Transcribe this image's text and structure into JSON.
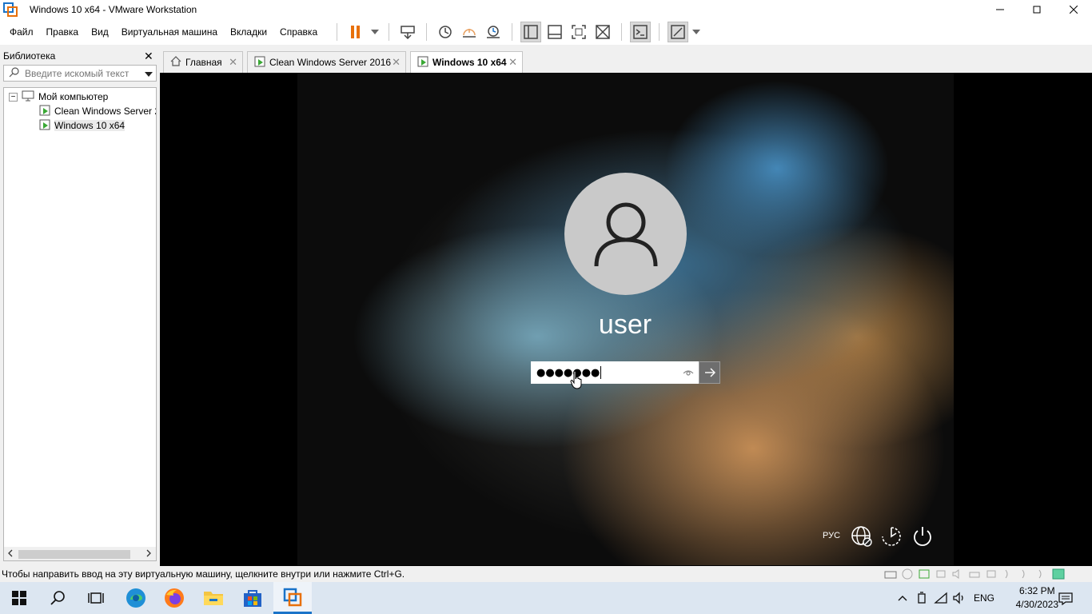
{
  "window": {
    "title": "Windows 10 x64 - VMware Workstation"
  },
  "menu": [
    "Файл",
    "Правка",
    "Вид",
    "Виртуальная машина",
    "Вкладки",
    "Справка"
  ],
  "library": {
    "header": "Библиотека",
    "search_placeholder": "Введите искомый текст",
    "tree": {
      "root": "Мой компьютер",
      "items": [
        "Clean Windows Server 2",
        "Windows 10 x64"
      ]
    }
  },
  "tabs": [
    {
      "label": "Главная"
    },
    {
      "label": "Clean Windows Server 2016"
    },
    {
      "label": "Windows 10 x64"
    }
  ],
  "lockscreen": {
    "username": "user",
    "password_mask": "●●●●●●●",
    "language": "РУС"
  },
  "statusbar": {
    "message": "Чтобы направить ввод на эту виртуальную машину, щелкните внутри или нажмите Ctrl+G."
  },
  "taskbar": {
    "input_lang": "ENG",
    "time": "6:32 PM",
    "date": "4/30/2023"
  },
  "colors": {
    "accent": "#1a73c8",
    "pause_orange": "#e8700a",
    "vm_green": "#3aa835"
  }
}
